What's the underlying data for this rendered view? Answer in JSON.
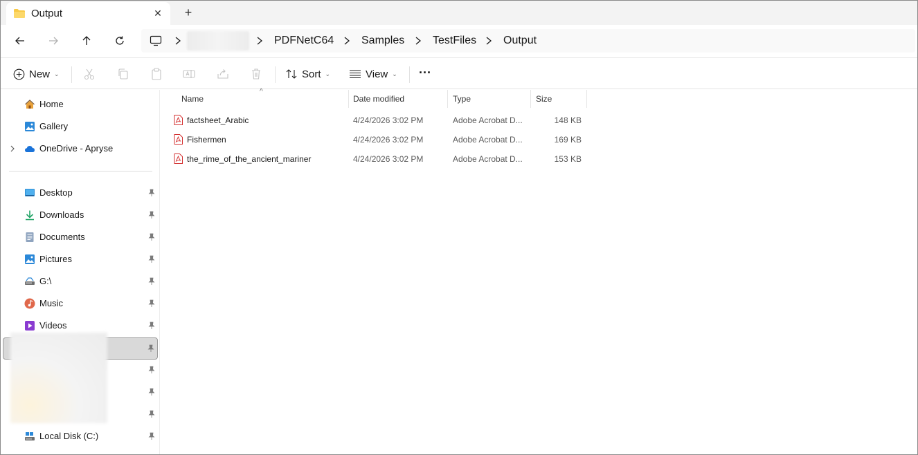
{
  "tab": {
    "title": "Output",
    "close": "✕",
    "new": "+"
  },
  "breadcrumb": {
    "items": [
      "PDFNetC64",
      "Samples",
      "TestFiles",
      "Output"
    ]
  },
  "commands": {
    "new_label": "New",
    "sort_label": "Sort",
    "view_label": "View",
    "more_label": "···"
  },
  "nav": {
    "home": "Home",
    "gallery": "Gallery",
    "onedrive": "OneDrive - Apryse",
    "desktop": "Desktop",
    "downloads": "Downloads",
    "documents": "Documents",
    "pictures": "Pictures",
    "gdrive": "G:\\",
    "music": "Music",
    "videos": "Videos",
    "localdisk": "Local Disk (C:)"
  },
  "columns": {
    "name": "Name",
    "date": "Date modified",
    "type": "Type",
    "size": "Size"
  },
  "files": [
    {
      "name": "factsheet_Arabic",
      "date": "4/24/2026 3:02 PM",
      "type": "Adobe Acrobat D...",
      "size": "148 KB"
    },
    {
      "name": "Fishermen",
      "date": "4/24/2026 3:02 PM",
      "type": "Adobe Acrobat D...",
      "size": "169 KB"
    },
    {
      "name": "the_rime_of_the_ancient_mariner",
      "date": "4/24/2026 3:02 PM",
      "type": "Adobe Acrobat D...",
      "size": "153 KB"
    }
  ],
  "colors": {
    "folder": "#f8c945",
    "pdf_red": "#d32f2f",
    "accent": "#0067c0"
  }
}
